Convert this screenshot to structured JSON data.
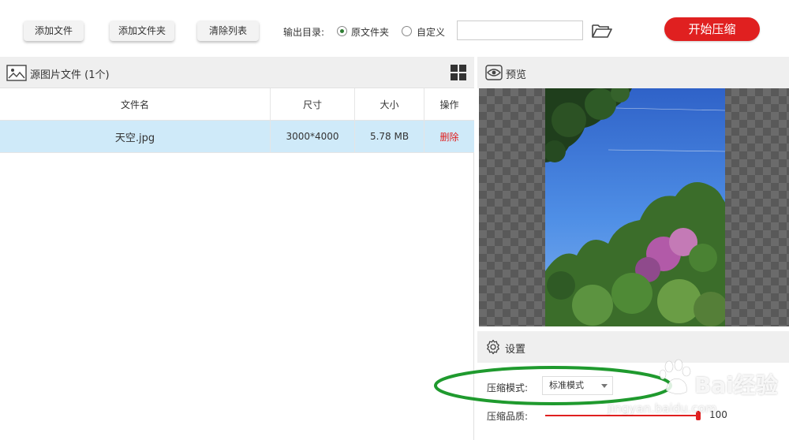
{
  "toolbar": {
    "add_file": "添加文件",
    "add_folder": "添加文件夹",
    "clear_list": "清除列表",
    "output_label": "输出目录:",
    "radio_original": "原文件夹",
    "radio_custom": "自定义",
    "selected_output": "原文件夹",
    "path_value": "",
    "start": "开始压缩"
  },
  "source": {
    "title": "源图片文件 (1个)",
    "columns": [
      "文件名",
      "尺寸",
      "大小",
      "操作"
    ],
    "rows": [
      {
        "name": "天空.jpg",
        "size": "3000*4000",
        "filesize": "5.78 MB",
        "action": "删除"
      }
    ]
  },
  "preview": {
    "title": "预览"
  },
  "settings": {
    "title": "设置",
    "mode_label": "压缩模式:",
    "mode_value": "标准模式",
    "quality_label": "压缩品质:",
    "quality_value": "100"
  },
  "watermark": {
    "brand": "Bai经验",
    "sub": "jingyan.baidu.com"
  },
  "colors": {
    "accent_red": "#e02020",
    "selected_row": "#cfeaf9",
    "annotation_green": "#1f9a2e"
  }
}
